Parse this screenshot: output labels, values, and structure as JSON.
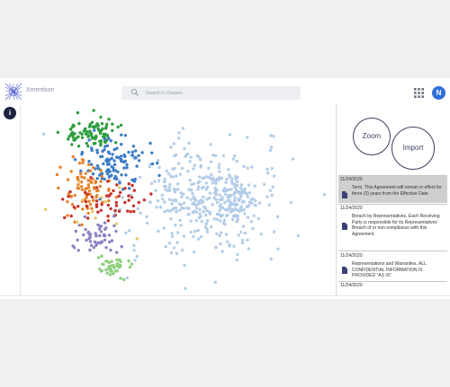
{
  "header": {
    "brand": "Xmentium",
    "search_placeholder": "Search in Clauses",
    "avatar_initial": "N"
  },
  "left_rail": {
    "info_label": "i"
  },
  "actions": {
    "zoom_label": "Zoom",
    "import_label": "Import"
  },
  "feed": [
    {
      "date": "11/24/2020",
      "text": "Term. This Agreement will remain in effect for three (3) years from the Effective Date.",
      "selected": true
    },
    {
      "date": "11/24/2020",
      "text": "Breach by Representatives. Each Receiving Party is responsible for its Representatives' Breach of or non-compliance with this Agreement.",
      "selected": false
    },
    {
      "date": "11/24/2020",
      "text": "Representations and Warranties. ALL CONFIDENTIAL INFORMATION IS PROVIDED \"AS IS\".",
      "selected": false
    },
    {
      "date": "11/24/2020",
      "text": "",
      "selected": false
    }
  ],
  "colors": {
    "accent": "#2f6fd8",
    "navy": "#1c2340",
    "cluster_green": "#2e9e3e",
    "cluster_blue": "#3a7cc7",
    "cluster_orange": "#e8822a",
    "cluster_red": "#c8302a",
    "cluster_purple": "#8a84c4",
    "cluster_lightgreen": "#8fcf7e",
    "cluster_lightblue": "#b3cde8",
    "cluster_yellow": "#e8c96a",
    "selected_card": "#cfcfcf"
  },
  "icons": [
    "logo-icon",
    "search-icon",
    "apps-grid-icon",
    "document-icon"
  ]
}
